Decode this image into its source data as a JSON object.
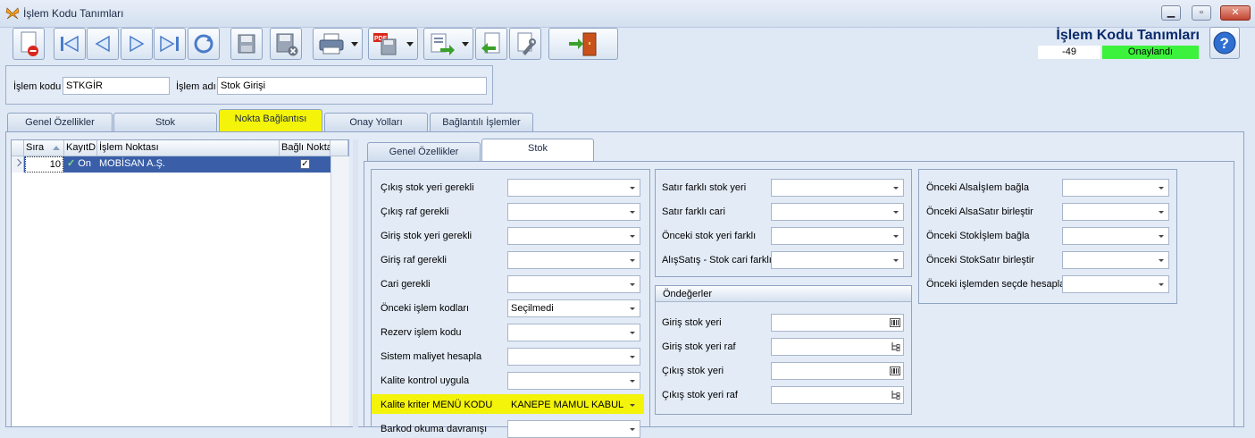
{
  "window": {
    "title": "İşlem Kodu Tanımları"
  },
  "toolbar": {
    "buttons": [
      {
        "name": "new-document-delete",
        "icon": "document-delete-icon"
      },
      {
        "name": "first-record",
        "icon": "first-icon"
      },
      {
        "name": "previous-record",
        "icon": "previous-icon"
      },
      {
        "name": "next-record",
        "icon": "next-icon"
      },
      {
        "name": "last-record",
        "icon": "last-icon"
      },
      {
        "name": "refresh",
        "icon": "refresh-icon"
      },
      {
        "name": "save",
        "icon": "save-icon"
      },
      {
        "name": "save-cancel",
        "icon": "save-cancel-icon"
      },
      {
        "name": "print",
        "icon": "printer-icon"
      },
      {
        "name": "pdf-save",
        "icon": "pdf-save-icon"
      },
      {
        "name": "export",
        "icon": "export-icon"
      },
      {
        "name": "import",
        "icon": "import-icon"
      },
      {
        "name": "tools",
        "icon": "tools-icon"
      },
      {
        "name": "exit",
        "icon": "exit-door-icon"
      }
    ]
  },
  "header": {
    "title": "İşlem Kodu Tanımları",
    "record_number": "-49",
    "status": "Onaylandı",
    "status_color": "#3cf23c"
  },
  "form": {
    "code_label": "İşlem kodu",
    "code_value": "STKGİR",
    "name_label": "İşlem adı",
    "name_value": "Stok Girişi"
  },
  "main_tabs": [
    "Genel Özellikler",
    "Stok",
    "Nokta Bağlantısı",
    "Onay Yolları",
    "Bağlantılı İşlemler"
  ],
  "active_main_tab": "Nokta Bağlantısı",
  "grid": {
    "columns": [
      "Sıra",
      "KayıtDı",
      "İşlem Noktası",
      "Bağlı Nokta"
    ],
    "rows": [
      {
        "sira": "10",
        "kayit": "On",
        "nokta": "MOBİSAN A.Ş.",
        "bagli": true
      }
    ]
  },
  "sub_tabs": [
    "Genel Özellikler",
    "Stok"
  ],
  "active_sub_tab": "Stok",
  "stock_fields": [
    {
      "label": "Çıkış stok yeri gerekli",
      "value": ""
    },
    {
      "label": "Çıkış raf gerekli",
      "value": ""
    },
    {
      "label": "Giriş stok yeri gerekli",
      "value": ""
    },
    {
      "label": "Giriş raf gerekli",
      "value": ""
    },
    {
      "label": "Cari gerekli",
      "value": ""
    },
    {
      "label": "Önceki işlem kodları",
      "value": "Seçilmedi"
    },
    {
      "label": "Rezerv işlem kodu",
      "value": ""
    },
    {
      "label": "Sistem maliyet hesapla",
      "value": ""
    },
    {
      "label": "Kalite kontrol uygula",
      "value": ""
    },
    {
      "label": "Kalite kriter MENÜ KODU",
      "value": "KANEPE MAMUL KABUL"
    },
    {
      "label": "Barkod okuma davranışı",
      "value": ""
    }
  ],
  "diff_fields": [
    {
      "label": "Satır farklı stok yeri",
      "value": ""
    },
    {
      "label": "Satır farklı cari",
      "value": ""
    },
    {
      "label": "Önceki stok yeri farklı",
      "value": ""
    },
    {
      "label": "AlışSatış - Stok cari farklı",
      "value": ""
    }
  ],
  "defaults_group": {
    "title": "Öndeğerler",
    "fields": [
      {
        "label": "Giriş stok yeri",
        "value": "",
        "icon": "barcode-icon"
      },
      {
        "label": "Giriş stok yeri raf",
        "value": "",
        "icon": "tree-icon"
      },
      {
        "label": "Çıkış stok yeri",
        "value": "",
        "icon": "barcode-icon"
      },
      {
        "label": "Çıkış stok yeri raf",
        "value": "",
        "icon": "tree-icon"
      }
    ]
  },
  "link_fields": [
    {
      "label": "Önceki AlsaİşIem bağla",
      "value": ""
    },
    {
      "label": "Önceki AlsaSatır birleştir",
      "value": ""
    },
    {
      "label": "Önceki Stokİşlem bağla",
      "value": ""
    },
    {
      "label": "Önceki StokSatır birleştir",
      "value": ""
    },
    {
      "label": "Önceki işlemden seçde hesapla",
      "value": ""
    }
  ],
  "highlight_color": "#f4f40a"
}
